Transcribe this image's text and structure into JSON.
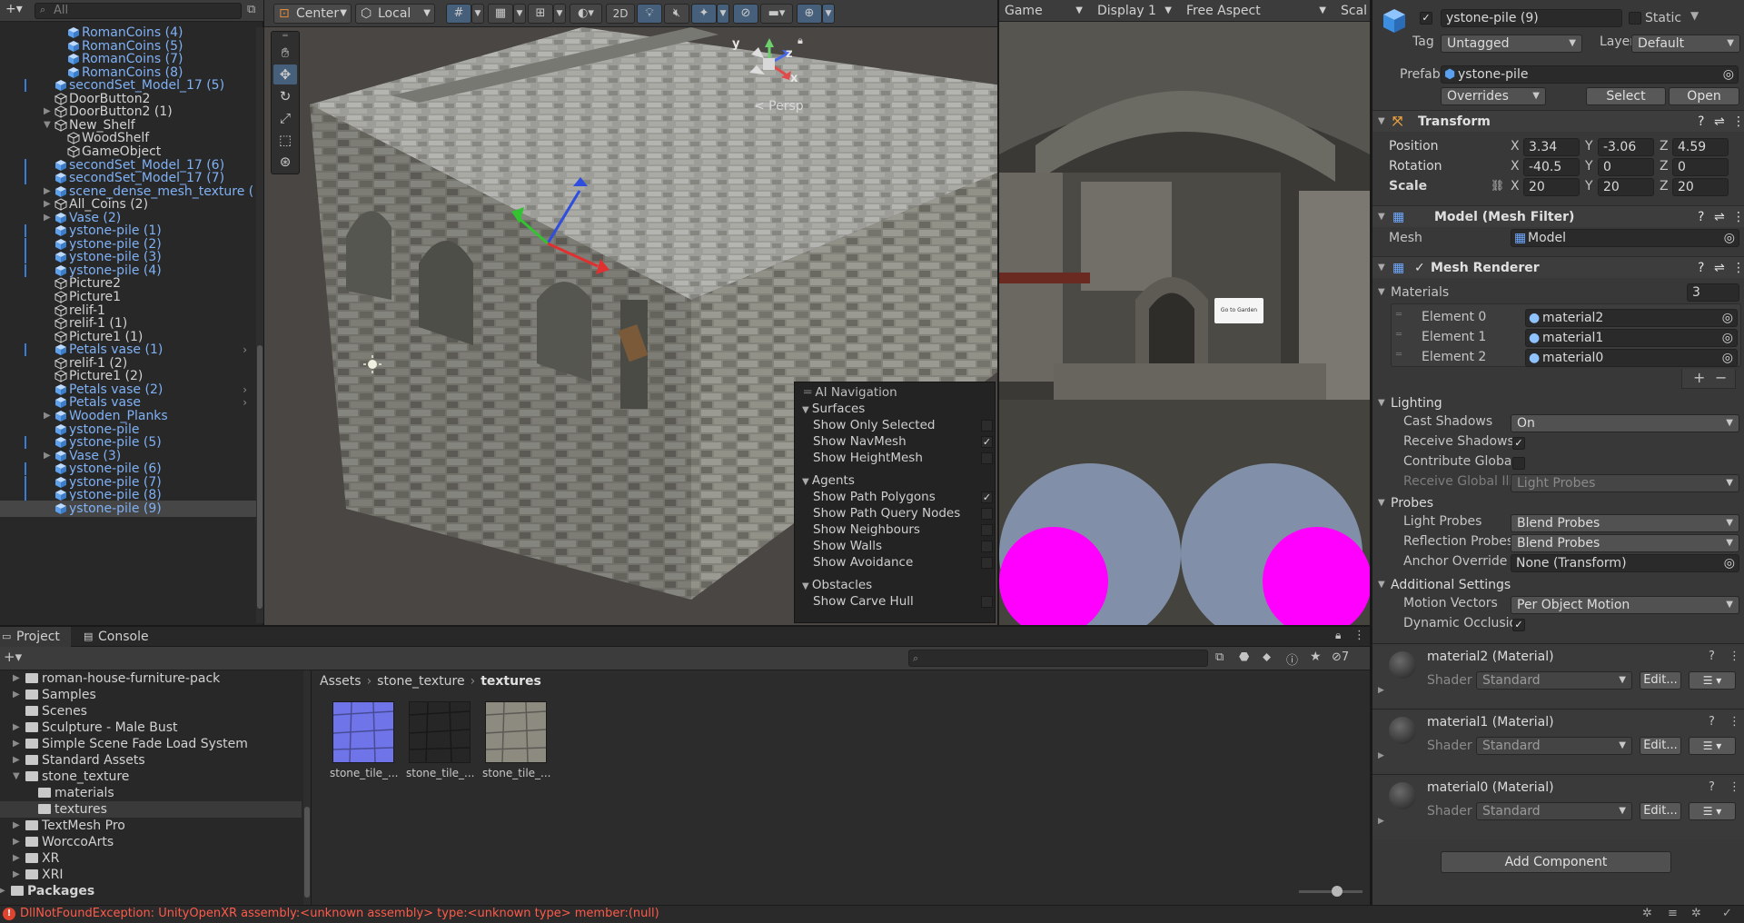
{
  "hierarchy": {
    "search_placeholder": "All",
    "rows": [
      {
        "label": "RomanCoins (4)",
        "style": "blue",
        "indent": 3
      },
      {
        "label": "RomanCoins (5)",
        "style": "blue",
        "indent": 3
      },
      {
        "label": "RomanCoins (7)",
        "style": "blue",
        "indent": 3
      },
      {
        "label": "RomanCoins (8)",
        "style": "blue",
        "indent": 3
      },
      {
        "label": "secondSet_Model_17 (5)",
        "style": "blue",
        "indent": 2,
        "mark": true
      },
      {
        "label": "DoorButton2",
        "style": "white",
        "indent": 2
      },
      {
        "label": "DoorButton2 (1)",
        "style": "white",
        "indent": 2,
        "expand": true
      },
      {
        "label": "New_Shelf",
        "style": "white",
        "indent": 2,
        "expand": true,
        "open": true
      },
      {
        "label": "WoodShelf",
        "style": "white",
        "indent": 3
      },
      {
        "label": "GameObject",
        "style": "white",
        "indent": 3
      },
      {
        "label": "secondSet_Model_17 (6)",
        "style": "blue",
        "indent": 2,
        "mark": true
      },
      {
        "label": "secondSet_Model_17 (7)",
        "style": "blue",
        "indent": 2,
        "mark": true
      },
      {
        "label": "scene_dense_mesh_texture (",
        "style": "blue",
        "indent": 2,
        "expand": true
      },
      {
        "label": "All_Coins (2)",
        "style": "white",
        "indent": 2,
        "expand": true
      },
      {
        "label": "Vase (2)",
        "style": "blue",
        "indent": 2,
        "expand": true
      },
      {
        "label": "ystone-pile (1)",
        "style": "blue",
        "indent": 2,
        "mark": true
      },
      {
        "label": "ystone-pile (2)",
        "style": "blue",
        "indent": 2,
        "mark": true
      },
      {
        "label": "ystone-pile (3)",
        "style": "blue",
        "indent": 2,
        "mark": true
      },
      {
        "label": "ystone-pile (4)",
        "style": "blue",
        "indent": 2,
        "mark": true
      },
      {
        "label": "Picture2",
        "style": "white",
        "indent": 2
      },
      {
        "label": "Picture1",
        "style": "white",
        "indent": 2
      },
      {
        "label": "relif-1",
        "style": "white",
        "indent": 2
      },
      {
        "label": "relif-1 (1)",
        "style": "white",
        "indent": 2
      },
      {
        "label": "Picture1 (1)",
        "style": "white",
        "indent": 2
      },
      {
        "label": "Petals vase (1)",
        "style": "blue",
        "indent": 2,
        "mark": true,
        "chev": true
      },
      {
        "label": "relif-1 (2)",
        "style": "white",
        "indent": 2
      },
      {
        "label": "Picture1 (2)",
        "style": "white",
        "indent": 2
      },
      {
        "label": "Petals vase (2)",
        "style": "blue",
        "indent": 2,
        "chev": true
      },
      {
        "label": "Petals vase",
        "style": "blue",
        "indent": 2,
        "chev": true
      },
      {
        "label": "Wooden_Planks",
        "style": "blue",
        "indent": 2,
        "expand": true
      },
      {
        "label": "ystone-pile",
        "style": "blue",
        "indent": 2
      },
      {
        "label": "ystone-pile (5)",
        "style": "blue",
        "indent": 2,
        "mark": true
      },
      {
        "label": "Vase (3)",
        "style": "blue",
        "indent": 2,
        "expand": true
      },
      {
        "label": "ystone-pile (6)",
        "style": "blue",
        "indent": 2,
        "mark": true
      },
      {
        "label": "ystone-pile (7)",
        "style": "blue",
        "indent": 2,
        "mark": true
      },
      {
        "label": "ystone-pile (8)",
        "style": "blue",
        "indent": 2,
        "mark": true
      },
      {
        "label": "ystone-pile (9)",
        "style": "blue",
        "indent": 2,
        "selected": true
      }
    ]
  },
  "scene": {
    "pivot": "Center",
    "space": "Local",
    "mode2d": "2D",
    "persp": "< Persp",
    "gizmo_axes": {
      "x": "x",
      "y": "y",
      "z": "z"
    },
    "ai_nav": {
      "title": "AI Navigation",
      "sections": [
        {
          "heading": "Surfaces",
          "items": [
            {
              "label": "Show Only Selected",
              "checked": false
            },
            {
              "label": "Show NavMesh",
              "checked": true
            },
            {
              "label": "Show HeightMesh",
              "checked": false
            }
          ]
        },
        {
          "heading": "Agents",
          "items": [
            {
              "label": "Show Path Polygons",
              "checked": true
            },
            {
              "label": "Show Path Query Nodes",
              "checked": false
            },
            {
              "label": "Show Neighbours",
              "checked": false
            },
            {
              "label": "Show Walls",
              "checked": false
            },
            {
              "label": "Show Avoidance",
              "checked": false
            }
          ]
        },
        {
          "heading": "Obstacles",
          "items": [
            {
              "label": "Show Carve Hull",
              "checked": false
            }
          ]
        }
      ]
    }
  },
  "game": {
    "tab": "Game",
    "display": "Display 1",
    "aspect": "Free Aspect",
    "scale": "Scal",
    "button_text": "Go to Garden"
  },
  "inspector": {
    "name": "ystone-pile (9)",
    "static_label": "Static",
    "tag_label": "Tag",
    "tag_value": "Untagged",
    "layer_label": "Layer",
    "layer_value": "Default",
    "prefab_label": "Prefab",
    "prefab_value": "ystone-pile",
    "overrides": "Overrides",
    "select": "Select",
    "open": "Open",
    "transform": {
      "title": "Transform",
      "position_label": "Position",
      "position": [
        "3.34",
        "-3.06",
        "4.59"
      ],
      "rotation_label": "Rotation",
      "rotation": [
        "-40.5",
        "0",
        "0"
      ],
      "scale_label": "Scale",
      "scale": [
        "20",
        "20",
        "20"
      ],
      "x": "X",
      "y": "Y",
      "z": "Z"
    },
    "mesh_filter": {
      "title": "Model (Mesh Filter)",
      "mesh_label": "Mesh",
      "mesh_value": "Model"
    },
    "mesh_renderer": {
      "title": "Mesh Renderer",
      "materials_label": "Materials",
      "materials_count": "3",
      "elements": [
        {
          "label": "Element 0",
          "value": "material2"
        },
        {
          "label": "Element 1",
          "value": "material1"
        },
        {
          "label": "Element 2",
          "value": "material0"
        }
      ],
      "plus": "+",
      "minus": "−",
      "lighting": "Lighting",
      "cast_shadows_label": "Cast Shadows",
      "cast_shadows": "On",
      "receive_shadows_label": "Receive Shadows",
      "contribute_gi_label": "Contribute Global Il",
      "receive_gi_label": "Receive Global Illur",
      "receive_gi": "Light Probes",
      "probes": "Probes",
      "light_probes_label": "Light Probes",
      "light_probes": "Blend Probes",
      "reflection_probes_label": "Reflection Probes",
      "reflection_probes": "Blend Probes",
      "anchor_label": "Anchor Override",
      "anchor": "None (Transform)",
      "additional": "Additional Settings",
      "motion_vectors_label": "Motion Vectors",
      "motion_vectors": "Per Object Motion",
      "dynamic_occlusion_label": "Dynamic Occlusion"
    },
    "materials": [
      {
        "title": "material2 (Material)",
        "shader_label": "Shader",
        "shader": "Standard",
        "edit": "Edit..."
      },
      {
        "title": "material1 (Material)",
        "shader_label": "Shader",
        "shader": "Standard",
        "edit": "Edit..."
      },
      {
        "title": "material0 (Material)",
        "shader_label": "Shader",
        "shader": "Standard",
        "edit": "Edit..."
      }
    ],
    "add_component": "Add Component"
  },
  "project": {
    "tab_project": "Project",
    "tab_console": "Console",
    "hidden_count": "7",
    "tree": [
      {
        "label": "roman-house-furniture-pack",
        "indent": 0,
        "expand": true
      },
      {
        "label": "Samples",
        "indent": 0,
        "expand": true
      },
      {
        "label": "Scenes",
        "indent": 0,
        "expand": false
      },
      {
        "label": "Sculpture - Male Bust",
        "indent": 0,
        "expand": true
      },
      {
        "label": "Simple Scene Fade Load System",
        "indent": 0,
        "expand": true
      },
      {
        "label": "Standard Assets",
        "indent": 0,
        "expand": true
      },
      {
        "label": "stone_texture",
        "indent": 0,
        "expand": true,
        "open": true
      },
      {
        "label": "materials",
        "indent": 1
      },
      {
        "label": "textures",
        "indent": 1,
        "selected": true
      },
      {
        "label": "TextMesh Pro",
        "indent": 0,
        "expand": true
      },
      {
        "label": "WorccoArts",
        "indent": 0,
        "expand": true
      },
      {
        "label": "XR",
        "indent": 0,
        "expand": true
      },
      {
        "label": "XRI",
        "indent": 0,
        "expand": true
      },
      {
        "label": "Packages",
        "indent": -1,
        "expand": true,
        "bold": true
      }
    ],
    "breadcrumb": [
      "Assets",
      "stone_texture",
      "textures"
    ],
    "assets": [
      {
        "label": "stone_tile_...",
        "color": "#6f74e8"
      },
      {
        "label": "stone_tile_...",
        "color": "#262626"
      },
      {
        "label": "stone_tile_...",
        "color": "#8d8a80"
      }
    ]
  },
  "status": {
    "error": "DllNotFoundException: UnityOpenXR assembly:<unknown assembly> type:<unknown type> member:(null)",
    "error_color": "#ff5a4a"
  }
}
